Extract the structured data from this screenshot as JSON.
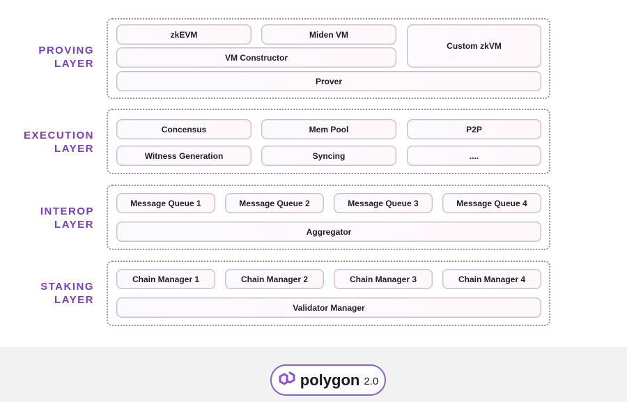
{
  "layers": [
    {
      "name": "proving",
      "label_line1": "PROVING",
      "label_line2": "LAYER",
      "components": [
        "zkEVM",
        "Miden VM",
        "Custom zkVM",
        "VM Constructor",
        "Prover"
      ]
    },
    {
      "name": "execution",
      "label_line1": "EXECUTION",
      "label_line2": "LAYER",
      "components": [
        "Concensus",
        "Mem Pool",
        "P2P",
        "Witness Generation",
        "Syncing",
        "...."
      ]
    },
    {
      "name": "interop",
      "label_line1": "INTEROP",
      "label_line2": "LAYER",
      "components": [
        "Message Queue 1",
        "Message Queue 2",
        "Message Queue 3",
        "Message Queue 4",
        "Aggregator"
      ]
    },
    {
      "name": "staking",
      "label_line1": "STAKING",
      "label_line2": "LAYER",
      "components": [
        "Chain Manager 1",
        "Chain Manager 2",
        "Chain Manager 3",
        "Chain Manager 4",
        "Validator Manager"
      ]
    }
  ],
  "footer": {
    "logo_icon": "polygon-logo-icon",
    "brand": "polygon",
    "version": "2.0"
  },
  "colors": {
    "label": "#7b3fb5",
    "logo": "#8d4fd6"
  }
}
